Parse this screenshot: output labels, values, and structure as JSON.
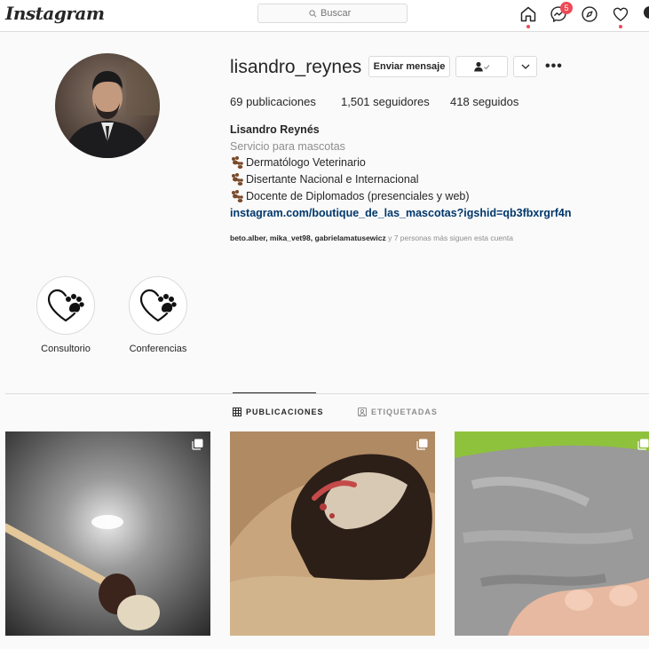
{
  "nav": {
    "logo": "Instagram",
    "search_placeholder": "Buscar",
    "notification_count": "5",
    "icons": [
      "home-icon",
      "messenger-icon",
      "explore-icon",
      "activity-heart-icon",
      "profile-avatar"
    ]
  },
  "profile": {
    "username": "lisandro_reynes",
    "message_button": "Enviar mensaje",
    "posts_count": "69",
    "posts_label": " publicaciones",
    "followers_count": "1,501",
    "followers_label": " seguidores",
    "following_count": "418",
    "following_label": " seguidos",
    "full_name": "Lisandro Reynés",
    "category": "Servicio para mascotas",
    "bio_lines": [
      "Dermatólogo Veterinario",
      "Disertante Nacional e Internacional",
      "Docente de Diplomados (presenciales y web)"
    ],
    "link": "instagram.com/boutique_de_las_mascotas?igshid=qb3fbxrgrf4n",
    "followed_by_users": "beto.alber, mika_vet98, gabrielamatusewicz",
    "followed_by_rest": " y 7 personas más siguen esta cuenta"
  },
  "highlights": [
    {
      "label": "Consultorio"
    },
    {
      "label": "Conferencias"
    }
  ],
  "tabs": [
    {
      "label": "PUBLICACIONES",
      "active": true
    },
    {
      "label": "ETIQUETADAS",
      "active": false
    }
  ],
  "colors": {
    "link": "#00376b",
    "secondary_text": "#8e8e8e",
    "notification": "#ed4956",
    "border": "#dbdbdb"
  }
}
